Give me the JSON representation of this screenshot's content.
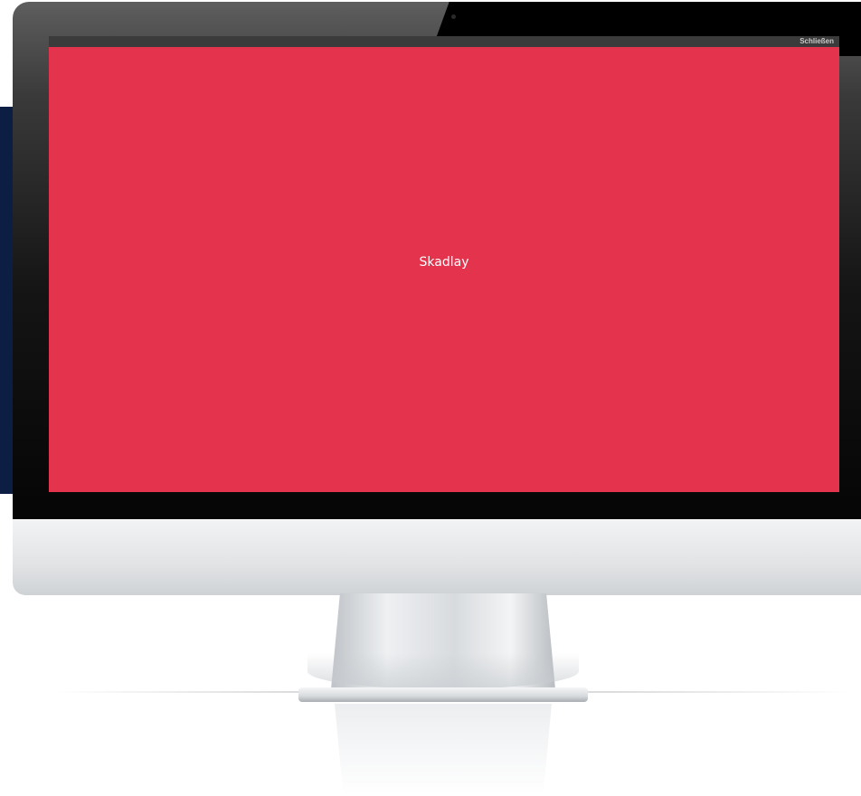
{
  "window": {
    "close_label": "Schließen"
  },
  "content": {
    "label": "Skadlay",
    "background_color": "#e3334d"
  },
  "colors": {
    "side_panel": "#0d1e44",
    "titlebar": "#3b3b3b"
  }
}
